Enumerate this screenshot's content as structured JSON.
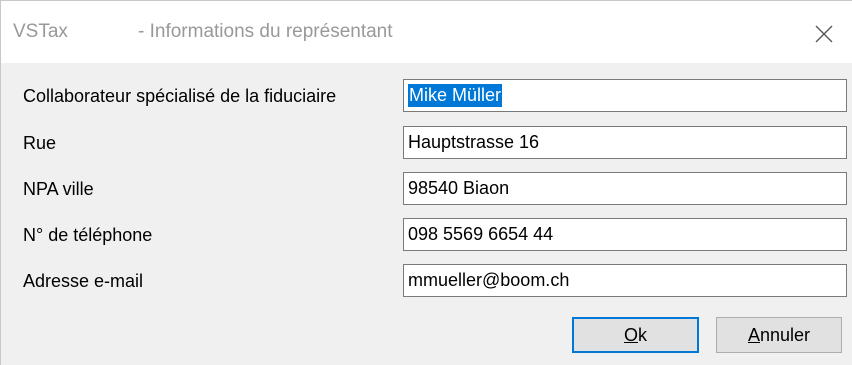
{
  "window": {
    "app_name": "VSTax",
    "title": "- Informations du représentant"
  },
  "form": {
    "fields": [
      {
        "label": "Collaborateur spécialisé de la fiduciaire",
        "value": "Mike Müller",
        "selected": true
      },
      {
        "label": "Rue",
        "value": "Hauptstrasse 16"
      },
      {
        "label": "NPA ville",
        "value": "98540 Biaon"
      },
      {
        "label": "N° de téléphone",
        "value": "098 5569 6654 44"
      },
      {
        "label": "Adresse e-mail",
        "value": "mmueller@boom.ch"
      }
    ]
  },
  "buttons": {
    "ok_label": "Ok",
    "ok_mnemonic": "O",
    "cancel_label": "Annuler",
    "cancel_mnemonic": "A"
  },
  "icons": {
    "close": "close-icon"
  },
  "colors": {
    "selection": "#0078d7",
    "default_button_border": "#0078d7",
    "dialog_background": "#f0f0f0"
  }
}
